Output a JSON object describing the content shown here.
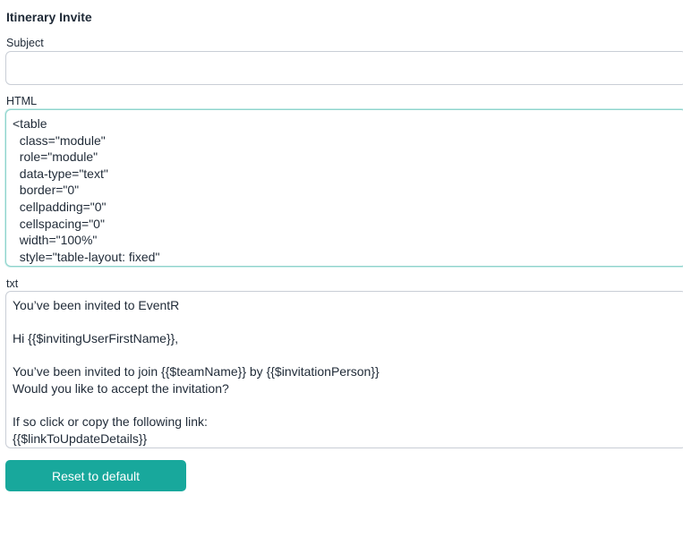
{
  "form": {
    "title": "Itinerary Invite",
    "subject": {
      "label": "Subject",
      "value": ""
    },
    "html": {
      "label": "HTML",
      "value": "<table\n  class=\"module\"\n  role=\"module\"\n  data-type=\"text\"\n  border=\"0\"\n  cellpadding=\"0\"\n  cellspacing=\"0\"\n  width=\"100%\"\n  style=\"table-layout: fixed\""
    },
    "txt": {
      "label": "txt",
      "value": "You’ve been invited to EventR\n\nHi {{$invitingUserFirstName}},\n\nYou’ve been invited to join {{$teamName}} by {{$invitationPerson}}\nWould you like to accept the invitation?\n\nIf so click or copy the following link:\n{{$linkToUpdateDetails}}"
    },
    "reset_label": "Reset to default"
  }
}
